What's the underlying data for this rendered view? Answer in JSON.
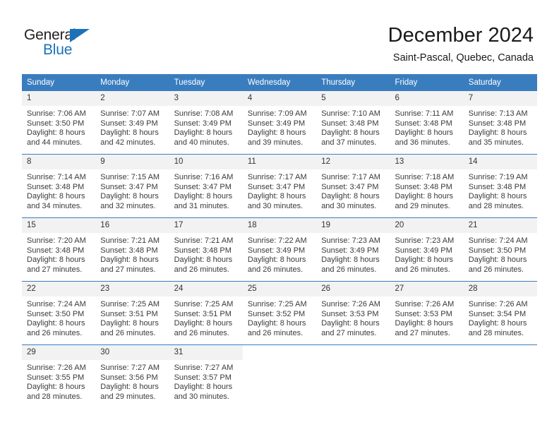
{
  "brand": {
    "name_part1": "General",
    "name_part2": "Blue",
    "accent_color": "#1b72b8"
  },
  "header": {
    "title": "December 2024",
    "subtitle": "Saint-Pascal, Quebec, Canada"
  },
  "calendar": {
    "header_color": "#3a7dbf",
    "weekday_headers": [
      "Sunday",
      "Monday",
      "Tuesday",
      "Wednesday",
      "Thursday",
      "Friday",
      "Saturday"
    ],
    "weeks": [
      [
        {
          "day": "1",
          "sunrise": "Sunrise: 7:06 AM",
          "sunset": "Sunset: 3:50 PM",
          "daylight_line1": "Daylight: 8 hours",
          "daylight_line2": "and 44 minutes."
        },
        {
          "day": "2",
          "sunrise": "Sunrise: 7:07 AM",
          "sunset": "Sunset: 3:49 PM",
          "daylight_line1": "Daylight: 8 hours",
          "daylight_line2": "and 42 minutes."
        },
        {
          "day": "3",
          "sunrise": "Sunrise: 7:08 AM",
          "sunset": "Sunset: 3:49 PM",
          "daylight_line1": "Daylight: 8 hours",
          "daylight_line2": "and 40 minutes."
        },
        {
          "day": "4",
          "sunrise": "Sunrise: 7:09 AM",
          "sunset": "Sunset: 3:49 PM",
          "daylight_line1": "Daylight: 8 hours",
          "daylight_line2": "and 39 minutes."
        },
        {
          "day": "5",
          "sunrise": "Sunrise: 7:10 AM",
          "sunset": "Sunset: 3:48 PM",
          "daylight_line1": "Daylight: 8 hours",
          "daylight_line2": "and 37 minutes."
        },
        {
          "day": "6",
          "sunrise": "Sunrise: 7:11 AM",
          "sunset": "Sunset: 3:48 PM",
          "daylight_line1": "Daylight: 8 hours",
          "daylight_line2": "and 36 minutes."
        },
        {
          "day": "7",
          "sunrise": "Sunrise: 7:13 AM",
          "sunset": "Sunset: 3:48 PM",
          "daylight_line1": "Daylight: 8 hours",
          "daylight_line2": "and 35 minutes."
        }
      ],
      [
        {
          "day": "8",
          "sunrise": "Sunrise: 7:14 AM",
          "sunset": "Sunset: 3:48 PM",
          "daylight_line1": "Daylight: 8 hours",
          "daylight_line2": "and 34 minutes."
        },
        {
          "day": "9",
          "sunrise": "Sunrise: 7:15 AM",
          "sunset": "Sunset: 3:47 PM",
          "daylight_line1": "Daylight: 8 hours",
          "daylight_line2": "and 32 minutes."
        },
        {
          "day": "10",
          "sunrise": "Sunrise: 7:16 AM",
          "sunset": "Sunset: 3:47 PM",
          "daylight_line1": "Daylight: 8 hours",
          "daylight_line2": "and 31 minutes."
        },
        {
          "day": "11",
          "sunrise": "Sunrise: 7:17 AM",
          "sunset": "Sunset: 3:47 PM",
          "daylight_line1": "Daylight: 8 hours",
          "daylight_line2": "and 30 minutes."
        },
        {
          "day": "12",
          "sunrise": "Sunrise: 7:17 AM",
          "sunset": "Sunset: 3:47 PM",
          "daylight_line1": "Daylight: 8 hours",
          "daylight_line2": "and 30 minutes."
        },
        {
          "day": "13",
          "sunrise": "Sunrise: 7:18 AM",
          "sunset": "Sunset: 3:48 PM",
          "daylight_line1": "Daylight: 8 hours",
          "daylight_line2": "and 29 minutes."
        },
        {
          "day": "14",
          "sunrise": "Sunrise: 7:19 AM",
          "sunset": "Sunset: 3:48 PM",
          "daylight_line1": "Daylight: 8 hours",
          "daylight_line2": "and 28 minutes."
        }
      ],
      [
        {
          "day": "15",
          "sunrise": "Sunrise: 7:20 AM",
          "sunset": "Sunset: 3:48 PM",
          "daylight_line1": "Daylight: 8 hours",
          "daylight_line2": "and 27 minutes."
        },
        {
          "day": "16",
          "sunrise": "Sunrise: 7:21 AM",
          "sunset": "Sunset: 3:48 PM",
          "daylight_line1": "Daylight: 8 hours",
          "daylight_line2": "and 27 minutes."
        },
        {
          "day": "17",
          "sunrise": "Sunrise: 7:21 AM",
          "sunset": "Sunset: 3:48 PM",
          "daylight_line1": "Daylight: 8 hours",
          "daylight_line2": "and 26 minutes."
        },
        {
          "day": "18",
          "sunrise": "Sunrise: 7:22 AM",
          "sunset": "Sunset: 3:49 PM",
          "daylight_line1": "Daylight: 8 hours",
          "daylight_line2": "and 26 minutes."
        },
        {
          "day": "19",
          "sunrise": "Sunrise: 7:23 AM",
          "sunset": "Sunset: 3:49 PM",
          "daylight_line1": "Daylight: 8 hours",
          "daylight_line2": "and 26 minutes."
        },
        {
          "day": "20",
          "sunrise": "Sunrise: 7:23 AM",
          "sunset": "Sunset: 3:49 PM",
          "daylight_line1": "Daylight: 8 hours",
          "daylight_line2": "and 26 minutes."
        },
        {
          "day": "21",
          "sunrise": "Sunrise: 7:24 AM",
          "sunset": "Sunset: 3:50 PM",
          "daylight_line1": "Daylight: 8 hours",
          "daylight_line2": "and 26 minutes."
        }
      ],
      [
        {
          "day": "22",
          "sunrise": "Sunrise: 7:24 AM",
          "sunset": "Sunset: 3:50 PM",
          "daylight_line1": "Daylight: 8 hours",
          "daylight_line2": "and 26 minutes."
        },
        {
          "day": "23",
          "sunrise": "Sunrise: 7:25 AM",
          "sunset": "Sunset: 3:51 PM",
          "daylight_line1": "Daylight: 8 hours",
          "daylight_line2": "and 26 minutes."
        },
        {
          "day": "24",
          "sunrise": "Sunrise: 7:25 AM",
          "sunset": "Sunset: 3:51 PM",
          "daylight_line1": "Daylight: 8 hours",
          "daylight_line2": "and 26 minutes."
        },
        {
          "day": "25",
          "sunrise": "Sunrise: 7:25 AM",
          "sunset": "Sunset: 3:52 PM",
          "daylight_line1": "Daylight: 8 hours",
          "daylight_line2": "and 26 minutes."
        },
        {
          "day": "26",
          "sunrise": "Sunrise: 7:26 AM",
          "sunset": "Sunset: 3:53 PM",
          "daylight_line1": "Daylight: 8 hours",
          "daylight_line2": "and 27 minutes."
        },
        {
          "day": "27",
          "sunrise": "Sunrise: 7:26 AM",
          "sunset": "Sunset: 3:53 PM",
          "daylight_line1": "Daylight: 8 hours",
          "daylight_line2": "and 27 minutes."
        },
        {
          "day": "28",
          "sunrise": "Sunrise: 7:26 AM",
          "sunset": "Sunset: 3:54 PM",
          "daylight_line1": "Daylight: 8 hours",
          "daylight_line2": "and 28 minutes."
        }
      ],
      [
        {
          "day": "29",
          "sunrise": "Sunrise: 7:26 AM",
          "sunset": "Sunset: 3:55 PM",
          "daylight_line1": "Daylight: 8 hours",
          "daylight_line2": "and 28 minutes."
        },
        {
          "day": "30",
          "sunrise": "Sunrise: 7:27 AM",
          "sunset": "Sunset: 3:56 PM",
          "daylight_line1": "Daylight: 8 hours",
          "daylight_line2": "and 29 minutes."
        },
        {
          "day": "31",
          "sunrise": "Sunrise: 7:27 AM",
          "sunset": "Sunset: 3:57 PM",
          "daylight_line1": "Daylight: 8 hours",
          "daylight_line2": "and 30 minutes."
        },
        null,
        null,
        null,
        null
      ]
    ]
  }
}
